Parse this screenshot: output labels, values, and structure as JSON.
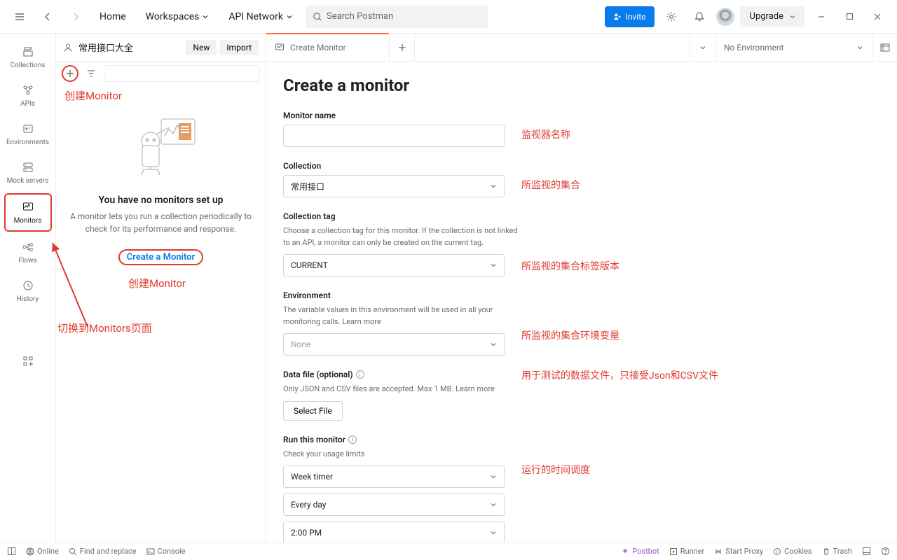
{
  "topbar": {
    "home": "Home",
    "workspaces": "Workspaces",
    "api_network": "API Network",
    "search_placeholder": "Search Postman",
    "invite": "Invite",
    "upgrade": "Upgrade"
  },
  "workspace": {
    "name": "常用接口大全",
    "new_btn": "New",
    "import_btn": "Import"
  },
  "sidebar": {
    "items": [
      {
        "label": "Collections"
      },
      {
        "label": "APIs"
      },
      {
        "label": "Environments"
      },
      {
        "label": "Mock servers"
      },
      {
        "label": "Monitors"
      },
      {
        "label": "Flows"
      },
      {
        "label": "History"
      }
    ]
  },
  "empty": {
    "title": "You have no monitors set up",
    "desc": "A monitor lets you run a collection periodically to check for its performance and response.",
    "cta": "Create a Monitor"
  },
  "tabs": {
    "active": "Create Monitor",
    "env": "No Environment"
  },
  "form": {
    "title": "Create a monitor",
    "monitor_name_label": "Monitor name",
    "collection_label": "Collection",
    "collection_value": "常用接口",
    "collection_tag_label": "Collection tag",
    "collection_tag_hint": "Choose a collection tag for this monitor. If the collection is not linked to an API, a monitor can only be created on the current tag.",
    "collection_tag_value": "CURRENT",
    "environment_label": "Environment",
    "environment_hint": "The variable values in this environment will be used in all your monitoring calls. Learn more",
    "environment_value": "None",
    "datafile_label": "Data file (optional)",
    "datafile_hint": "Only JSON and CSV files are accepted. Max 1 MB. Learn more",
    "select_file": "Select File",
    "run_label": "Run this monitor",
    "run_hint": "Check your usage limits",
    "run_timer": "Week timer",
    "run_day": "Every day",
    "run_time": "2:00 PM"
  },
  "annotations": {
    "create_monitor_top": "创建Monitor",
    "create_monitor_mid": "创建Monitor",
    "switch_page": "切换到Monitors页面",
    "monitor_name": "监视器名称",
    "collection": "所监视的集合",
    "collection_tag": "所监视的集合标签版本",
    "environment": "所监视的集合环境变量",
    "datafile": "用于测试的数据文件，只接受Json和CSV文件",
    "schedule": "运行的时间调度"
  },
  "statusbar": {
    "online": "Online",
    "find": "Find and replace",
    "console": "Console",
    "postbot": "Postbot",
    "runner": "Runner",
    "proxy": "Start Proxy",
    "cookies": "Cookies",
    "trash": "Trash"
  }
}
